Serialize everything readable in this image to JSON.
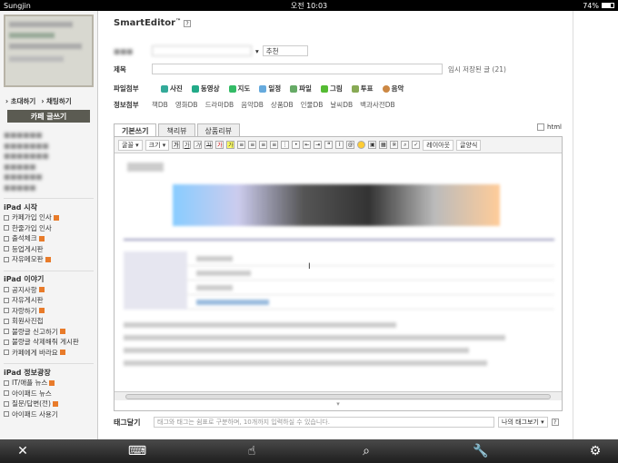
{
  "status": {
    "carrier": "Sungjin",
    "time": "오전 10:03",
    "battery": "74%",
    "battery_level": 0.74
  },
  "sidebar": {
    "actions": [
      "초대하기",
      "채팅하기"
    ],
    "write_button": "카페 글쓰기",
    "sections": [
      {
        "title": "iPad 시작",
        "items": [
          "카페가입 인사",
          "한줄가입 인사",
          "출석체크",
          "등업게시판",
          "자유메모판"
        ]
      },
      {
        "title": "iPad 이야기",
        "items": [
          "공지사항",
          "자유게시판",
          "자랑하기",
          "회원사진첩",
          "불량글 신고하기",
          "불량글 삭제해줘 게시판",
          "카페에게 바라요"
        ]
      },
      {
        "title": "iPad 정보광장",
        "items": [
          "IT/애플 뉴스",
          "아이패드 뉴스",
          "질문/답변(전)",
          "아이패드 사용기"
        ]
      }
    ]
  },
  "editor": {
    "logo": "SmartEditor",
    "logo_tm": "™",
    "help": "?",
    "headline_option": "추천",
    "title_label": "제목",
    "autosave": "임시 저장된 글 (21)",
    "attach_label": "파일첨부",
    "attach": [
      "사진",
      "동영상",
      "지도",
      "일정",
      "파일",
      "그림",
      "투표",
      "음악"
    ],
    "info_label": "정보첨부",
    "info": [
      "책DB",
      "영화DB",
      "드라마DB",
      "음악DB",
      "상품DB",
      "인물DB",
      "날씨DB",
      "백과사전DB"
    ],
    "tabs": [
      "기본쓰기",
      "책리뷰",
      "상품리뷰"
    ],
    "html_label": "html",
    "toolbar": {
      "font": "굴꼴",
      "size": "크기",
      "layout": "레이아웃",
      "quote": "글양식"
    },
    "tag_label": "태그달기",
    "tag_placeholder": "태그와 태그는 쉼표로 구분하며, 10개까지 입력하실 수 있습니다.",
    "my_tags": "나의 태그보기"
  }
}
